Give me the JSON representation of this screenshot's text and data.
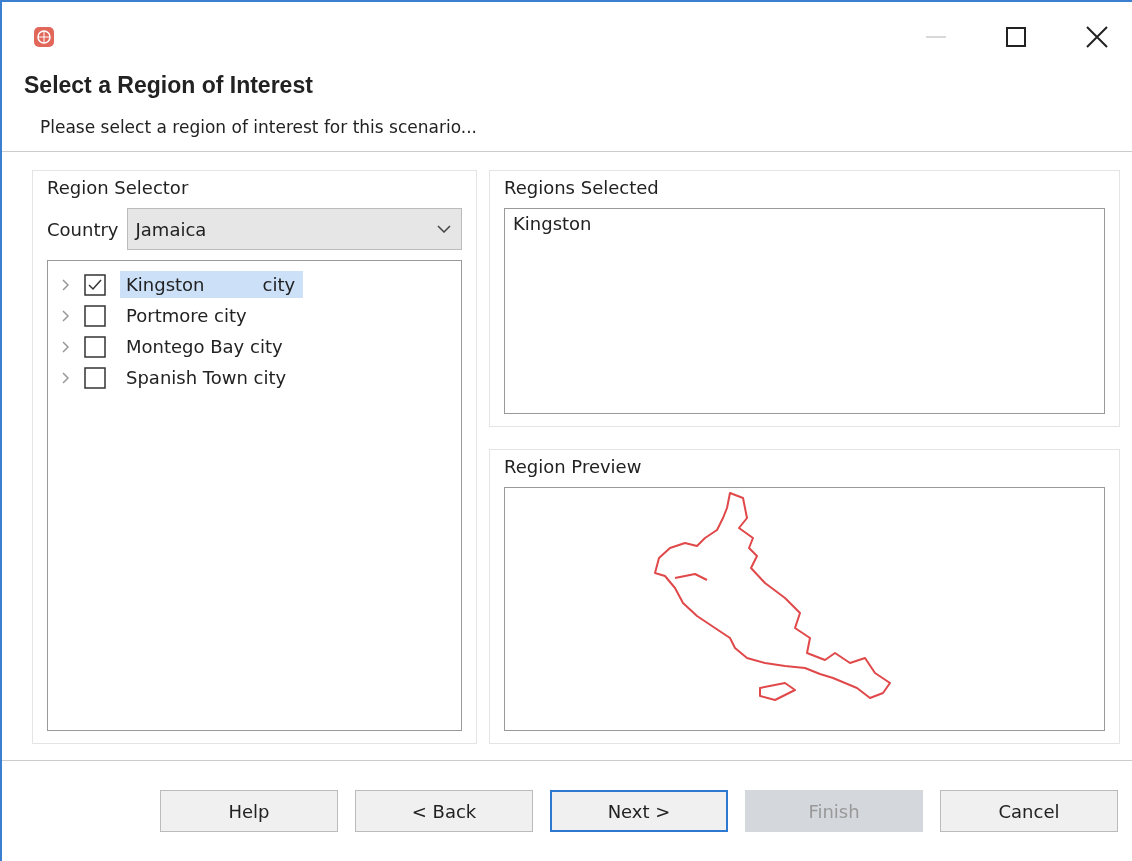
{
  "window": {
    "title": "Select a Region of Interest",
    "subtitle": "Please select a region of interest for this scenario..."
  },
  "region_selector": {
    "title": "Region Selector",
    "country_label": "Country",
    "country_value": "Jamaica",
    "items": [
      {
        "label": "Kingston",
        "suffix": "city",
        "checked": true,
        "selected": true
      },
      {
        "label": "Portmore city",
        "checked": false,
        "selected": false
      },
      {
        "label": "Montego Bay city",
        "checked": false,
        "selected": false
      },
      {
        "label": "Spanish Town city",
        "checked": false,
        "selected": false
      }
    ]
  },
  "regions_selected": {
    "title": "Regions Selected",
    "items": [
      "Kingston"
    ]
  },
  "region_preview": {
    "title": "Region Preview"
  },
  "buttons": [
    {
      "label": "Help",
      "focused": false,
      "disabled": false
    },
    {
      "label": "< Back",
      "focused": false,
      "disabled": false
    },
    {
      "label": "Next >",
      "focused": true,
      "disabled": false
    },
    {
      "label": "Finish",
      "focused": false,
      "disabled": true
    },
    {
      "label": "Cancel",
      "focused": false,
      "disabled": false
    }
  ]
}
